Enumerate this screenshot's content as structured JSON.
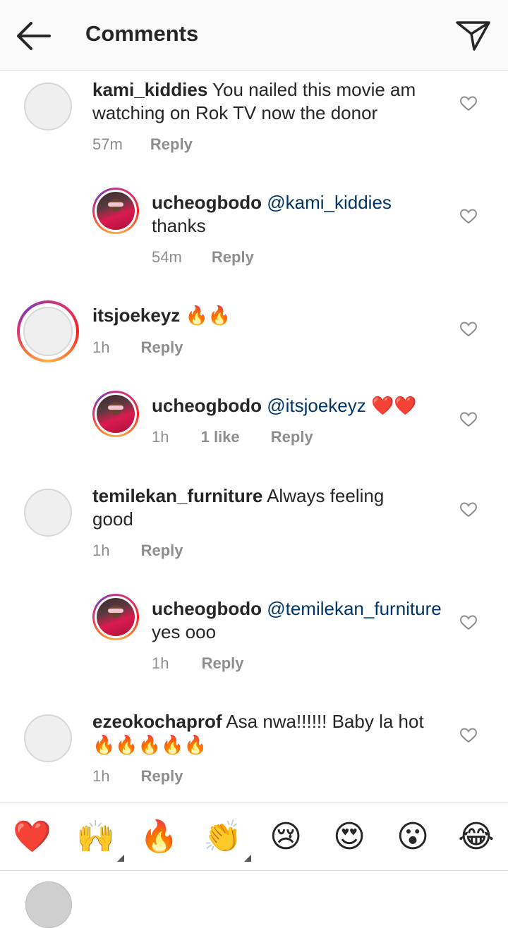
{
  "header": {
    "title": "Comments",
    "back_icon": "arrow-left-icon",
    "send_icon": "paper-plane-icon"
  },
  "comments": [
    {
      "username": "kami_kiddies",
      "mention": "",
      "text": "You nailed this movie am watching on Rok TV now the donor",
      "time": "57m",
      "likes": "",
      "reply_label": "Reply"
    },
    {
      "username": "ucheogbodo",
      "mention": "@kami_kiddies",
      "text": "thanks",
      "time": "54m",
      "likes": "",
      "reply_label": "Reply"
    },
    {
      "username": "itsjoekeyz",
      "mention": "",
      "text": "🔥🔥",
      "time": "1h",
      "likes": "",
      "reply_label": "Reply"
    },
    {
      "username": "ucheogbodo",
      "mention": "@itsjoekeyz",
      "text": "❤️❤️",
      "time": "1h",
      "likes": "1 like",
      "reply_label": "Reply"
    },
    {
      "username": "temilekan_furniture",
      "mention": "",
      "text": "Always feeling good",
      "time": "1h",
      "likes": "",
      "reply_label": "Reply"
    },
    {
      "username": "ucheogbodo",
      "mention": "@temilekan_furniture",
      "text": "yes ooo",
      "time": "1h",
      "likes": "",
      "reply_label": "Reply"
    },
    {
      "username": "ezeokochaprof",
      "mention": "",
      "text": "Asa nwa!!!!!! Baby la hot 🔥🔥🔥🔥🔥",
      "time": "1h",
      "likes": "",
      "reply_label": "Reply"
    }
  ],
  "emoji_bar": [
    "❤️",
    "🙌",
    "🔥",
    "👏",
    "😢",
    "😍",
    "😮",
    "😂"
  ],
  "colors": {
    "mention": "#003569",
    "meta": "#8e8e8e",
    "text": "#262626",
    "divider": "#dbdbdb"
  }
}
